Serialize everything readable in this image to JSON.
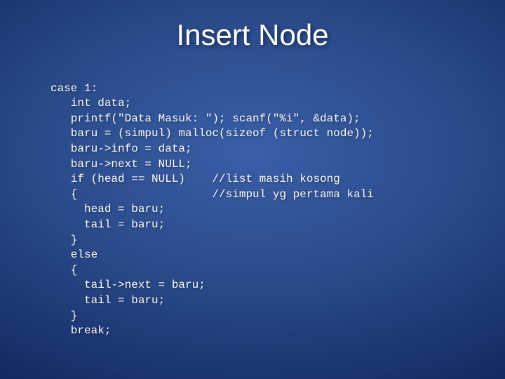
{
  "title": "Insert Node",
  "code": {
    "l01": "case 1:",
    "l02": "   int data;",
    "l03": "   printf(\"Data Masuk: \"); scanf(\"%i\", &data);",
    "l04": "   baru = (simpul) malloc(sizeof (struct node));",
    "l05": "   baru->info = data;",
    "l06": "   baru->next = NULL;",
    "l07": "   if (head == NULL)    //list masih kosong",
    "l08": "   {                    //simpul yg pertama kali",
    "l09": "     head = baru;",
    "l10": "     tail = baru;",
    "l11": "   }",
    "l12": "   else",
    "l13": "   {",
    "l14": "     tail->next = baru;",
    "l15": "     tail = baru;",
    "l16": "   }",
    "l17": "   break;"
  }
}
